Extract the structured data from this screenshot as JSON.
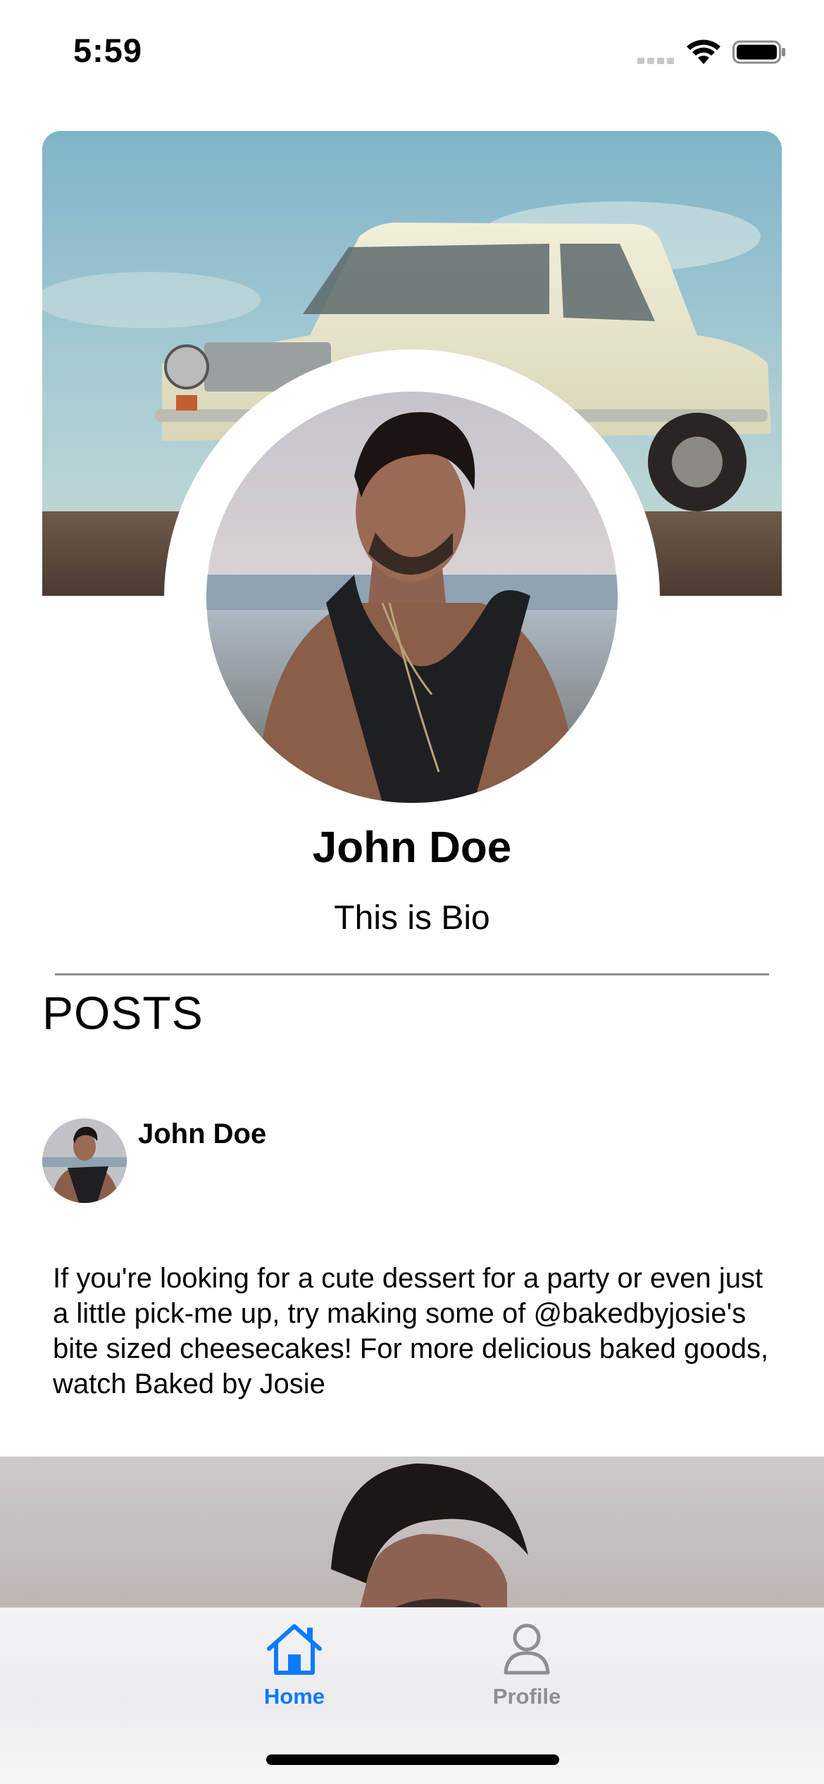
{
  "status_bar": {
    "time": "5:59"
  },
  "profile": {
    "name": "John Doe",
    "bio": "This is Bio"
  },
  "posts_section": {
    "heading": "POSTS"
  },
  "post": {
    "author": "John Doe",
    "text": "If you're looking for a cute dessert for a party or even just a little pick-me up, try making some of @bakedbyjosie's bite sized cheesecakes! For more delicious baked goods, watch Baked by Josie"
  },
  "tab_bar": {
    "tabs": [
      {
        "label": "Home",
        "icon": "house-icon",
        "active": true
      },
      {
        "label": "Profile",
        "icon": "person-icon",
        "active": false
      }
    ],
    "active_color": "#0a7aff",
    "inactive_color": "#8e8e93"
  }
}
